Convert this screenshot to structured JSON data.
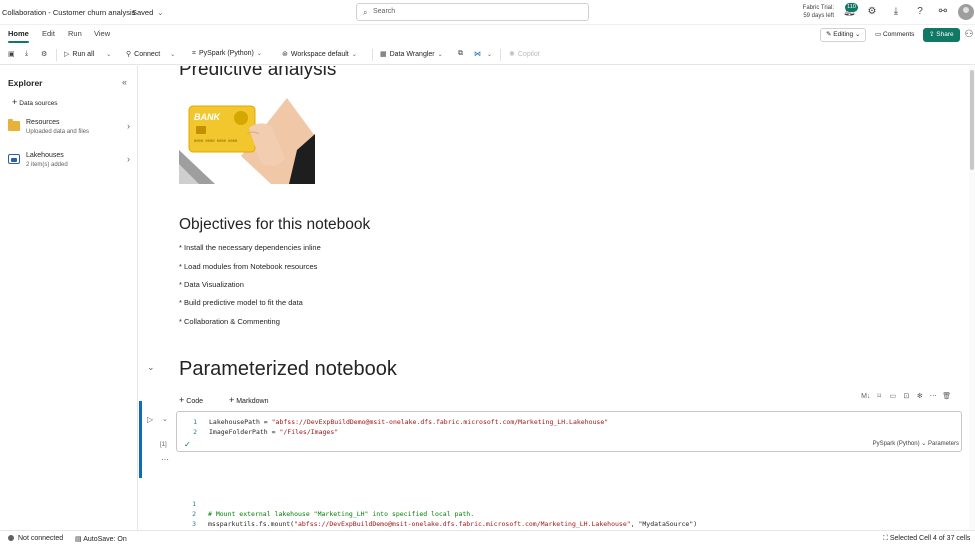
{
  "header": {
    "title": "Collaboration - Customer churn analysis",
    "saved_label": "Saved",
    "search_placeholder": "Search",
    "trial_line1": "Fabric Trial:",
    "trial_line2": "59 days left",
    "notification_count": "110"
  },
  "ribbon": {
    "tabs": [
      "Home",
      "Edit",
      "Run",
      "View"
    ],
    "active_tab": "Home",
    "editing_label": "Editing",
    "comments_label": "Comments",
    "share_label": "Share"
  },
  "toolbar": {
    "run_all": "Run all",
    "connect": "Connect",
    "language": "PySpark (Python)",
    "workspace": "Workspace default",
    "data_wrangler": "Data Wrangler",
    "copilot": "Copilot"
  },
  "explorer": {
    "title": "Explorer",
    "data_sources": "Data sources",
    "items": [
      {
        "name": "Resources",
        "sub": "Uploaded data and files"
      },
      {
        "name": "Lakehouses",
        "sub": "2 item(s) added"
      }
    ]
  },
  "notebook": {
    "heading_top": "Predictive analysis",
    "card_text": "BANK",
    "card_number": "0000 0000 0000 0000",
    "objectives_heading": "Objectives for this notebook",
    "bullets": [
      "* Install the necessary dependencies inline",
      "* Load modules from Notebook resources",
      "* Data Visualization",
      "* Build predictive model to fit the data",
      "* Collaboration & Commenting"
    ],
    "param_heading": "Parameterized notebook",
    "add_code": "Code",
    "add_markdown": "Markdown",
    "cell1": {
      "lines": [
        {
          "num": "1",
          "var": "LakehousePath = ",
          "str": "\"abfss://DevExpBuildDemo@msit-onelake.dfs.fabric.microsoft.com/Marketing_LH.Lakehouse\""
        },
        {
          "num": "2",
          "var": "ImageFolderPath = ",
          "str": "\"/Files/Images\""
        }
      ],
      "exec_count": "[1]",
      "language": "PySpark (Python)",
      "tag": "Parameters"
    },
    "cell2": {
      "lines": [
        {
          "num": "1",
          "text": ""
        },
        {
          "num": "2",
          "text": "# Mount external lakehouse  \"Marketing_LH\" into specified local path."
        },
        {
          "num": "3",
          "text": "mssparkutils.fs.mount(",
          "str": "\"abfss://DevExpBuildDemo@msit-onelake.dfs.fabric.microsoft.com/Marketing_LH.Lakehouse\"",
          "tail": ", \"MydataSource\")"
        }
      ]
    }
  },
  "status": {
    "connection": "Not connected",
    "autosave": "AutoSave: On",
    "selection": "Selected Cell 4 of 37 cells"
  },
  "colors": {
    "accent": "#117865",
    "active_cell": "#0f6cbd"
  }
}
